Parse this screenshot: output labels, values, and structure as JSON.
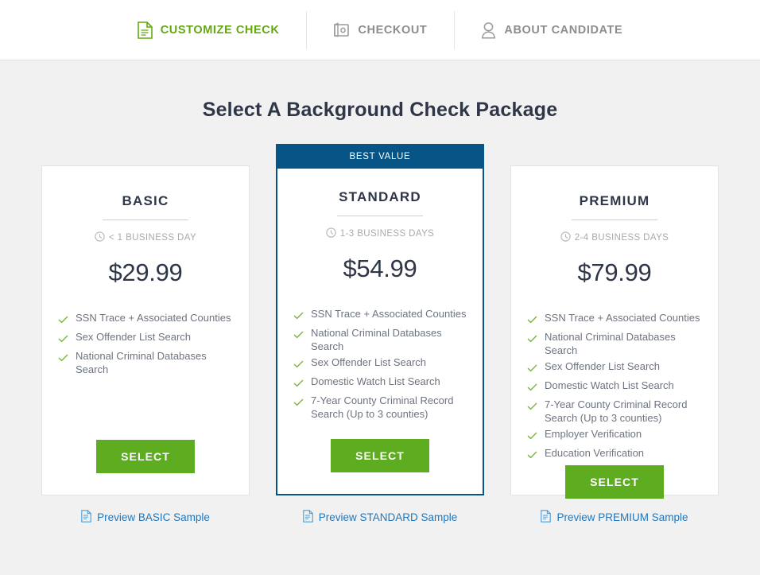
{
  "nav": {
    "items": [
      {
        "label": "CUSTOMIZE CHECK",
        "icon": "document-icon",
        "active": true
      },
      {
        "label": "CHECKOUT",
        "icon": "wallet-icon",
        "active": false
      },
      {
        "label": "ABOUT CANDIDATE",
        "icon": "user-icon",
        "active": false
      }
    ]
  },
  "page": {
    "title": "Select A Background Check Package"
  },
  "colors": {
    "accent_green": "#5ead21",
    "nav_active_green": "#63a80f",
    "featured_blue": "#075586",
    "title_navy": "#2e3648",
    "link_blue": "#2277bb",
    "body_bg": "#f1f1f1"
  },
  "packages": [
    {
      "name": "BASIC",
      "badge": null,
      "eta": "< 1 BUSINESS DAY",
      "price": "$29.99",
      "features": [
        "SSN Trace + Associated Counties",
        "Sex Offender List Search",
        "National Criminal Databases Search"
      ],
      "select_label": "SELECT",
      "preview_label": "Preview BASIC Sample",
      "featured": false
    },
    {
      "name": "STANDARD",
      "badge": "BEST VALUE",
      "eta": "1-3 BUSINESS DAYS",
      "price": "$54.99",
      "features": [
        "SSN Trace + Associated Counties",
        "National Criminal Databases Search",
        "Sex Offender List Search",
        "Domestic Watch List Search",
        "7-Year County Criminal Record Search (Up to 3 counties)"
      ],
      "select_label": "SELECT",
      "preview_label": "Preview STANDARD Sample",
      "featured": true
    },
    {
      "name": "PREMIUM",
      "badge": null,
      "eta": "2-4 BUSINESS DAYS",
      "price": "$79.99",
      "features": [
        "SSN Trace + Associated Counties",
        "National Criminal Databases Search",
        "Sex Offender List Search",
        "Domestic Watch List Search",
        "7-Year County Criminal Record Search (Up to 3 counties)",
        "Employer Verification",
        "Education Verification"
      ],
      "select_label": "SELECT",
      "preview_label": "Preview PREMIUM Sample",
      "featured": false
    }
  ]
}
